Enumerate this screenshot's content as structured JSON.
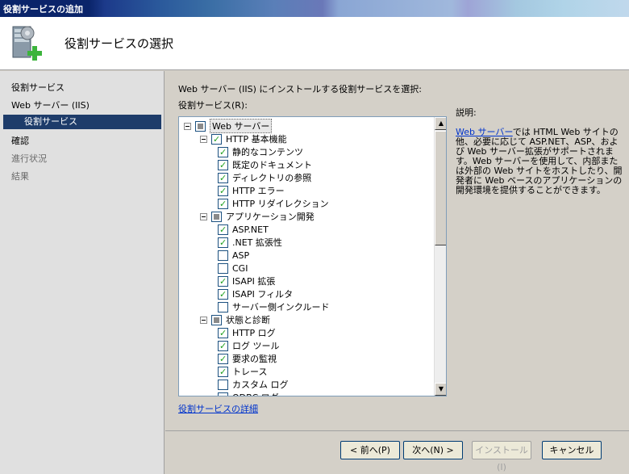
{
  "window": {
    "title": "役割サービスの追加"
  },
  "header": {
    "title": "役割サービスの選択",
    "icon": "server-add-icon"
  },
  "nav": {
    "items": [
      {
        "label": "役割サービス",
        "state": "normal"
      },
      {
        "label": "Web サーバー (IIS)",
        "state": "normal"
      },
      {
        "label": "役割サービス",
        "state": "selected"
      },
      {
        "label": "確認",
        "state": "normal"
      },
      {
        "label": "進行状況",
        "state": "disabled"
      },
      {
        "label": "結果",
        "state": "disabled"
      }
    ]
  },
  "main": {
    "instruction": "Web サーバー (IIS) にインストールする役割サービスを選択:",
    "list_label": "役割サービス(R):",
    "details_link": "役割サービスの詳細",
    "tree": [
      {
        "level": 0,
        "label": "Web サーバー",
        "state": "partial",
        "expander": true,
        "highlight": true
      },
      {
        "level": 1,
        "label": "HTTP 基本機能",
        "state": "checked",
        "expander": true
      },
      {
        "level": 2,
        "label": "静的なコンテンツ",
        "state": "checked"
      },
      {
        "level": 2,
        "label": "既定のドキュメント",
        "state": "checked"
      },
      {
        "level": 2,
        "label": "ディレクトリの参照",
        "state": "checked"
      },
      {
        "level": 2,
        "label": "HTTP エラー",
        "state": "checked"
      },
      {
        "level": 2,
        "label": "HTTP リダイレクション",
        "state": "checked"
      },
      {
        "level": 1,
        "label": "アプリケーション開発",
        "state": "partial",
        "expander": true
      },
      {
        "level": 2,
        "label": "ASP.NET",
        "state": "checked"
      },
      {
        "level": 2,
        "label": ".NET 拡張性",
        "state": "checked"
      },
      {
        "level": 2,
        "label": "ASP",
        "state": "unchecked"
      },
      {
        "level": 2,
        "label": "CGI",
        "state": "unchecked"
      },
      {
        "level": 2,
        "label": "ISAPI 拡張",
        "state": "checked"
      },
      {
        "level": 2,
        "label": "ISAPI フィルタ",
        "state": "checked"
      },
      {
        "level": 2,
        "label": "サーバー側インクルード",
        "state": "unchecked"
      },
      {
        "level": 1,
        "label": "状態と診断",
        "state": "partial",
        "expander": true
      },
      {
        "level": 2,
        "label": "HTTP ログ",
        "state": "checked"
      },
      {
        "level": 2,
        "label": "ログ ツール",
        "state": "checked"
      },
      {
        "level": 2,
        "label": "要求の監視",
        "state": "checked"
      },
      {
        "level": 2,
        "label": "トレース",
        "state": "checked"
      },
      {
        "level": 2,
        "label": "カスタム ログ",
        "state": "unchecked"
      },
      {
        "level": 2,
        "label": "ODBC ログ",
        "state": "unchecked"
      }
    ]
  },
  "description": {
    "heading": "説明:",
    "link": "Web サーバー",
    "text": "では HTML Web サイトの他、必要に応じて ASP.NET、ASP、および Web サーバー拡張がサポートされます。Web サーバーを使用して、内部または外部の Web サイトをホストしたり、開発者に Web ベースのアプリケーションの開発環境を提供することができます。"
  },
  "footer": {
    "back": "< 前へ(P)",
    "next": "次へ(N) >",
    "install": "インストール(I)",
    "cancel": "キャンセル"
  }
}
